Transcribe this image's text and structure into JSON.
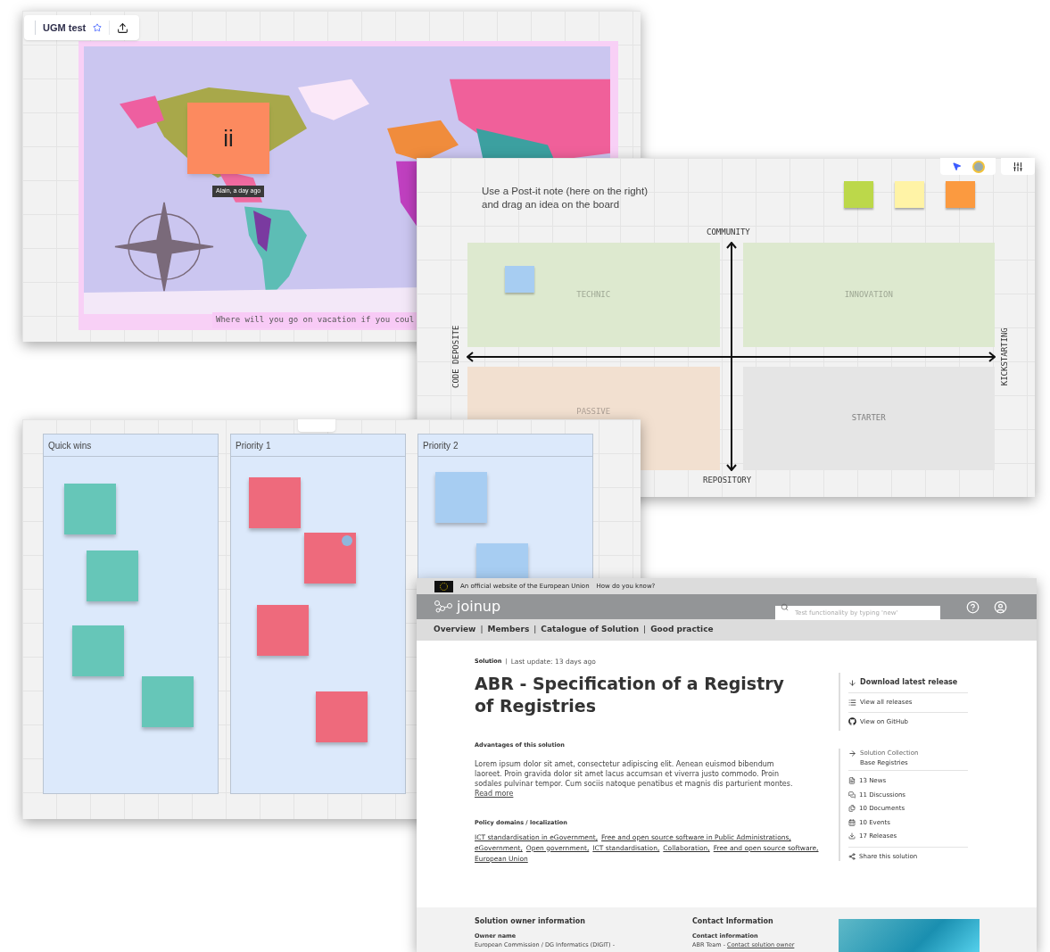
{
  "map_board": {
    "title": "UGM test",
    "starred": true,
    "sticky_note": {
      "text": "ii",
      "color": "#fc8a5f"
    },
    "tooltip": "Alain, a day ago",
    "caption": "Where will you go on vacation if you coul"
  },
  "quadrant_board": {
    "instruction_lines": [
      "Use a Post-it note (here on the right)",
      "and drag an idea on the board"
    ],
    "palette": [
      {
        "color": "#bcd84a"
      },
      {
        "color": "#fff3a6"
      },
      {
        "color": "#fb9a40"
      }
    ],
    "axes": {
      "top": "COMMUNITY",
      "bottom": "REPOSITORY",
      "left": "CODE DEPOSITE",
      "right": "KICKSTARTING"
    },
    "quadrants": [
      {
        "label": "TECHNIC",
        "color": "#dde9cf",
        "notes": [
          {
            "color": "#a7cdf2"
          }
        ]
      },
      {
        "label": "INNOVATION",
        "color": "#dde9cf"
      },
      {
        "label": "PASSIVE",
        "color": "#f2e0d0"
      },
      {
        "label": "STARTER",
        "color": "#e5e5e5"
      }
    ]
  },
  "kanban": {
    "columns": [
      {
        "title": "Quick wins",
        "notes": [
          {
            "color": "#66c6b8",
            "dot": false
          },
          {
            "color": "#66c6b8",
            "dot": false
          },
          {
            "color": "#66c6b8",
            "dot": false
          },
          {
            "color": "#66c6b8",
            "dot": false
          }
        ]
      },
      {
        "title": "Priority 1",
        "notes": [
          {
            "color": "#ee6a7c",
            "dot": false
          },
          {
            "color": "#ee6a7c",
            "dot": true
          },
          {
            "color": "#ee6a7c",
            "dot": false
          },
          {
            "color": "#ee6a7c",
            "dot": false
          }
        ]
      },
      {
        "title": "Priority 2",
        "notes": [
          {
            "color": "#a7cdf2",
            "dot": false
          },
          {
            "color": "#a7cdf2",
            "dot": false
          }
        ]
      }
    ]
  },
  "joinup": {
    "eu_bar": {
      "text": "An official website of the European Union",
      "link": "How do you know?"
    },
    "logo": "joinup",
    "search": {
      "placeholder": "Test functionality by typing 'new'"
    },
    "nav": {
      "separator": "|",
      "items": [
        "Overview",
        "Members",
        "Catalogue of Solution",
        "Good practice"
      ]
    },
    "meta": {
      "type": "Solution",
      "separator": "|",
      "updated": "Last update: 13 days ago"
    },
    "title": "ABR - Specification of a Registry of Registries",
    "advantages": {
      "heading": "Advantages of this solution",
      "text": "Lorem ipsum dolor sit amet, consectetur adipiscing elit. Aenean euismod bibendum laoreet. Proin gravida dolor sit amet lacus accumsan et viverra justo commodo. Proin sodales pulvinar tempor. Cum sociis natoque penatibus et magnis dis parturient montes.",
      "link": "Read more"
    },
    "policy": {
      "heading": "Policy domains / localization",
      "links": [
        "ICT standardisation in eGovernment,",
        "Free and open source software in Public Administrations,",
        "eGovernment,",
        "Open government,",
        "ICT standardisation,",
        "Collaboration,",
        "Free and open source software,",
        "European Union"
      ]
    },
    "release_links": [
      "Download latest release",
      "View all releases",
      "View on GitHub"
    ],
    "collection": {
      "label": "Solution Collection",
      "name": "Base Registries"
    },
    "counts": [
      "13 News",
      "11 Discussions",
      "10 Documents",
      "10 Events",
      "17 Releases"
    ],
    "share": "Share this solution",
    "footer": {
      "owner_heading": "Solution owner information",
      "owner_label": "Owner name",
      "owner_value": "European Commission / DG Informatics (DIGIT) -",
      "contact_heading": "Contact Information",
      "contact_label": "Contact information",
      "contact_value": "ABR Team -",
      "contact_link": "Contact solution owner"
    }
  }
}
